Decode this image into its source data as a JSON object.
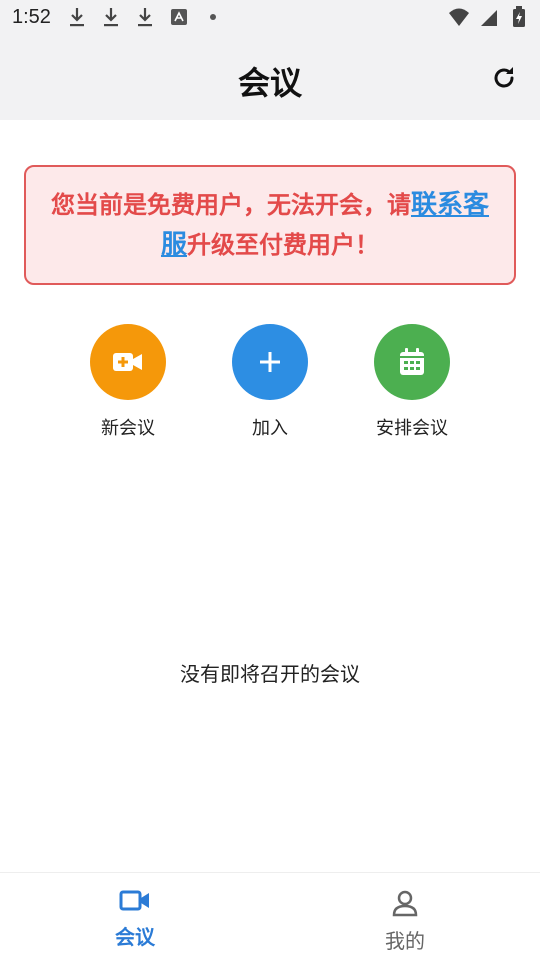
{
  "status_bar": {
    "time": "1:52"
  },
  "header": {
    "title": "会议"
  },
  "notice": {
    "text_before": "您当前是免费用户，无法开会，请",
    "link": "联系客服",
    "text_after": "升级至付费用户！"
  },
  "actions": [
    {
      "label": "新会议",
      "color": "#f5980a",
      "icon": "video-plus-icon"
    },
    {
      "label": "加入",
      "color": "#2d8ee3",
      "icon": "plus-icon"
    },
    {
      "label": "安排会议",
      "color": "#4caf50",
      "icon": "calendar-icon"
    }
  ],
  "empty_state": {
    "text": "没有即将召开的会议"
  },
  "bottom_nav": {
    "items": [
      {
        "label": "会议",
        "icon": "video-icon",
        "active": true
      },
      {
        "label": "我的",
        "icon": "person-icon",
        "active": false
      }
    ]
  },
  "colors": {
    "accent": "#2b7bd6",
    "warning_text": "#e34a4a",
    "warning_bg": "#fde9ea"
  }
}
